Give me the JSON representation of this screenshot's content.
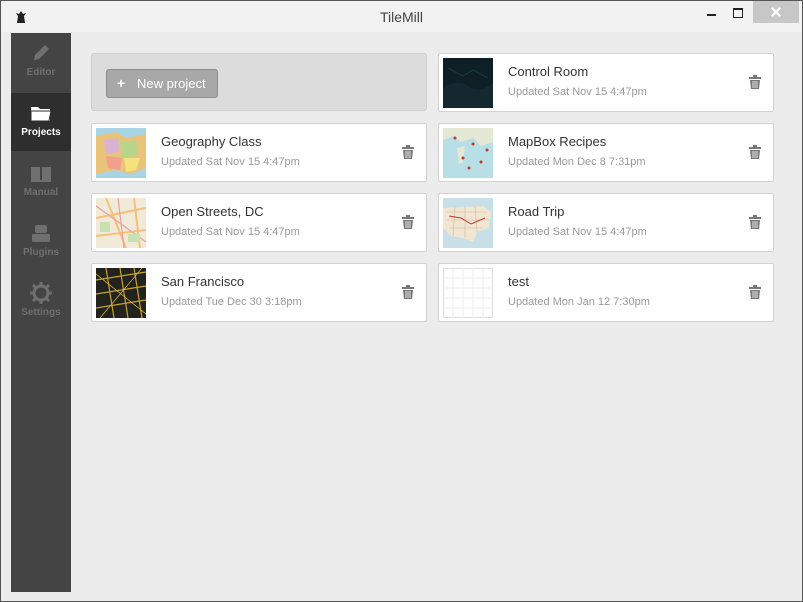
{
  "window": {
    "title": "TileMill"
  },
  "sidebar": {
    "items": [
      {
        "label": "Editor",
        "icon": "pencil-icon",
        "active": false
      },
      {
        "label": "Projects",
        "icon": "folder-icon",
        "active": true
      },
      {
        "label": "Manual",
        "icon": "book-icon",
        "active": false
      },
      {
        "label": "Plugins",
        "icon": "plugin-icon",
        "active": false
      },
      {
        "label": "Settings",
        "icon": "gear-icon",
        "active": false
      }
    ]
  },
  "main": {
    "new_project_label": "New project",
    "projects": [
      {
        "title": "Control Room",
        "updated": "Updated Sat Nov 15 4:47pm"
      },
      {
        "title": "Geography Class",
        "updated": "Updated Sat Nov 15 4:47pm"
      },
      {
        "title": "MapBox Recipes",
        "updated": "Updated Mon Dec 8 7:31pm"
      },
      {
        "title": "Open Streets, DC",
        "updated": "Updated Sat Nov 15 4:47pm"
      },
      {
        "title": "Road Trip",
        "updated": "Updated Sat Nov 15 4:47pm"
      },
      {
        "title": "San Francisco",
        "updated": "Updated Tue Dec 30 3:18pm"
      },
      {
        "title": "test",
        "updated": "Updated Mon Jan 12 7:30pm"
      }
    ]
  },
  "colors": {
    "sidebar": "#444444",
    "sidebar_active": "#2e2e2e",
    "background": "#ececec",
    "button": "#a8a8a8"
  }
}
